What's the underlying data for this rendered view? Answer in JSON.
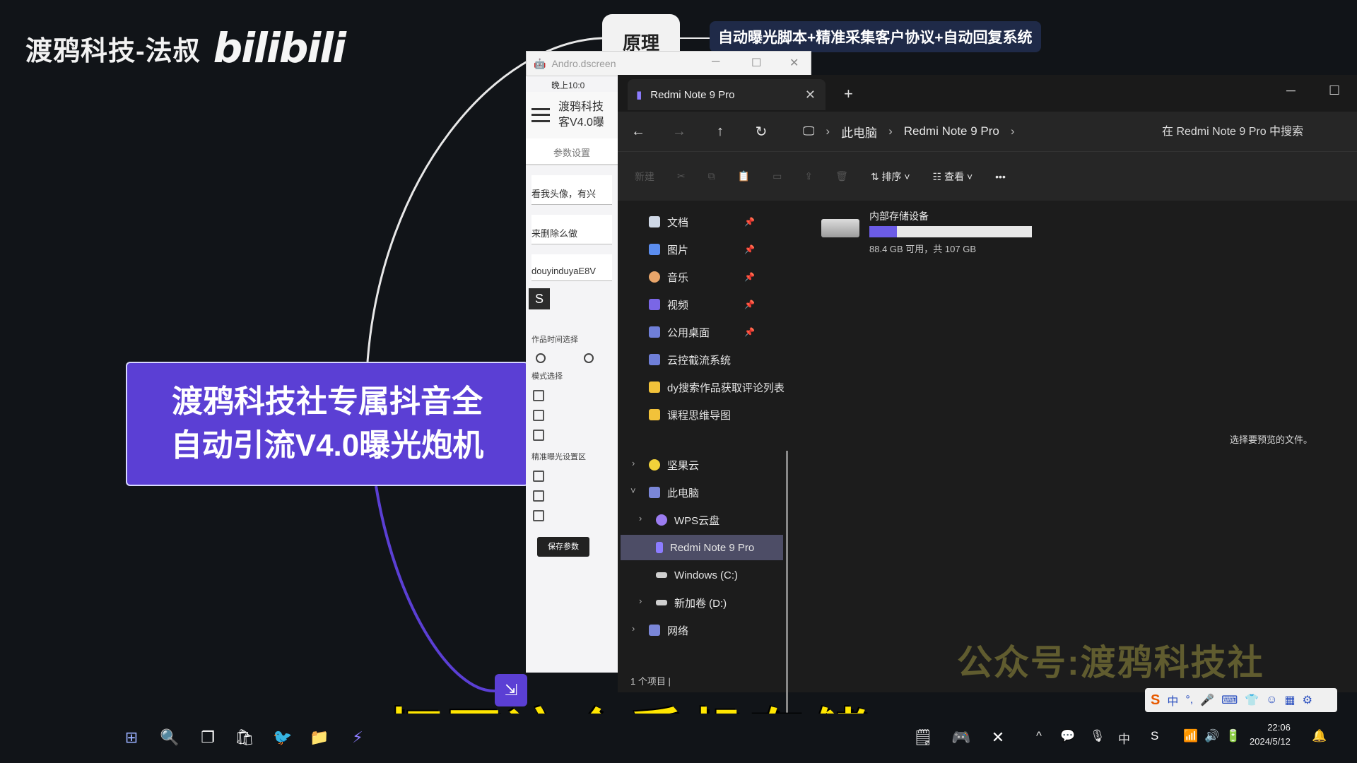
{
  "brand": {
    "name": "渡鸦科技-法叔",
    "logo_text": "bilibili"
  },
  "mindmap": {
    "node_principle": "原理",
    "node_principle_desc": "自动曝光脚本+精准采集客户协议+自动回复系统",
    "node_main_line1": "渡鸦科技社专属抖音全",
    "node_main_line2": "自动引流V4.0曝光炮机"
  },
  "phone_window": {
    "title": "Andro.dscreen",
    "status_time": "晚上10:0",
    "app_title_line1": "渡鸦科技",
    "app_title_line2": "客V4.0曝",
    "tab_label": "参数设置",
    "field1_value": "看我头像，有兴",
    "field2_value": "来删除么做",
    "field3_value": "douyinduyaE8V",
    "section_time": "作品时间选择",
    "section_mode": "模式选择",
    "section_precise": "精准曝光设置区",
    "save_label": "保存参数"
  },
  "explorer": {
    "tab_title": "Redmi Note 9 Pro",
    "breadcrumb": [
      "此电脑",
      "Redmi Note 9 Pro"
    ],
    "search_placeholder": "在 Redmi Note 9 Pro 中搜索",
    "toolbar": {
      "new_label": "新建",
      "sort_label": "排序",
      "view_label": "查看",
      "more_label": "•••"
    },
    "sidebar": [
      {
        "label": "文档",
        "icon": "document-icon",
        "pinned": true
      },
      {
        "label": "图片",
        "icon": "picture-icon",
        "pinned": true
      },
      {
        "label": "音乐",
        "icon": "music-icon",
        "pinned": true
      },
      {
        "label": "视频",
        "icon": "video-icon",
        "pinned": true
      },
      {
        "label": "公用桌面",
        "icon": "desktop-icon",
        "pinned": true
      },
      {
        "label": "云控截流系统",
        "icon": "folder-icon",
        "pinned": false
      },
      {
        "label": "dy搜索作品获取评论列表",
        "icon": "folder-icon",
        "pinned": false
      },
      {
        "label": "课程思维导图",
        "icon": "folder-icon",
        "pinned": false
      },
      {
        "label": "坚果云",
        "icon": "nutstore-icon",
        "pinned": false
      },
      {
        "label": "此电脑",
        "icon": "computer-icon",
        "pinned": false
      },
      {
        "label": "WPS云盘",
        "icon": "cloud-icon",
        "pinned": false
      },
      {
        "label": "Redmi Note 9 Pro",
        "icon": "phone-icon",
        "pinned": false
      },
      {
        "label": "Windows (C:)",
        "icon": "drive-icon",
        "pinned": false
      },
      {
        "label": "新加卷 (D:)",
        "icon": "drive-icon",
        "pinned": false
      },
      {
        "label": "网络",
        "icon": "network-icon",
        "pinned": false
      }
    ],
    "drive": {
      "name": "内部存储设备",
      "free_text": "88.4 GB 可用，共 107 GB",
      "used_fraction": 0.17
    },
    "preview_hint": "选择要预览的文件。",
    "status_text": "1 个项目  |"
  },
  "watermark": "公众号:渡鸦科技社",
  "subtitle": "打开这个手机存储",
  "ime": {
    "lang": "中"
  },
  "taskbar": {
    "tray_lang": "中",
    "time": "22:06",
    "date": "2024/5/12"
  },
  "colors": {
    "mindmap_accent": "#5b3fd4",
    "subtitle": "#ffe600",
    "selection": "#4d4d66"
  }
}
